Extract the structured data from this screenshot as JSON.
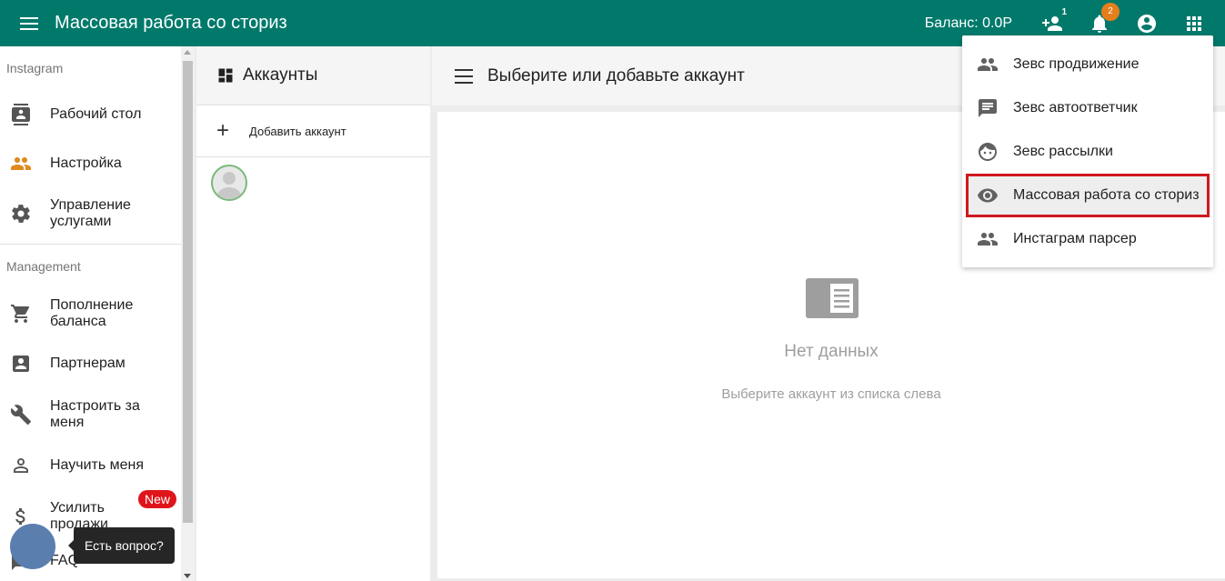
{
  "topbar": {
    "title": "Массовая работа со сториз",
    "balance": "Баланс: 0.0Р",
    "add_user_count": "1",
    "notifications_count": "2"
  },
  "sidebar": {
    "section_instagram": "Instagram",
    "section_management": "Management",
    "items": [
      {
        "label": "Рабочий стол",
        "icon": "dashboard-contact-icon"
      },
      {
        "label": "Настройка",
        "icon": "people-icon"
      },
      {
        "label": "Управление услугами",
        "icon": "gear-icon"
      },
      {
        "label": "Пополнение баланса",
        "icon": "cart-icon"
      },
      {
        "label": "Партнерам",
        "icon": "contact-card-icon"
      },
      {
        "label": "Настроить за меня",
        "icon": "wrench-icon"
      },
      {
        "label": "Научить меня",
        "icon": "person-icon"
      },
      {
        "label": "Усилить продажи",
        "icon": "dollar-icon"
      },
      {
        "label": "FAQ",
        "icon": "faq-icon"
      }
    ],
    "new_badge": "New"
  },
  "help": {
    "tooltip": "Есть вопрос?"
  },
  "accounts": {
    "title": "Аккаунты",
    "add_label": "Добавить аккаунт"
  },
  "main": {
    "title": "Выберите или добавьте аккаунт",
    "empty_title": "Нет данных",
    "empty_subtitle": "Выберите аккаунт из списка слева"
  },
  "dropdown": {
    "items": [
      {
        "label": "Зевс продвижение",
        "icon": "people-icon"
      },
      {
        "label": "Зевс автоответчик",
        "icon": "chat-icon"
      },
      {
        "label": "Зевс рассылки",
        "icon": "smile-icon"
      },
      {
        "label": "Массовая работа со сториз",
        "icon": "eye-icon",
        "active": true
      },
      {
        "label": "Инстаграм парсер",
        "icon": "people-icon"
      }
    ]
  },
  "colors": {
    "topbar": "#00796b",
    "accent_orange": "#e08a1e",
    "new_badge": "#e0151b",
    "highlight_border": "#d0181f"
  }
}
